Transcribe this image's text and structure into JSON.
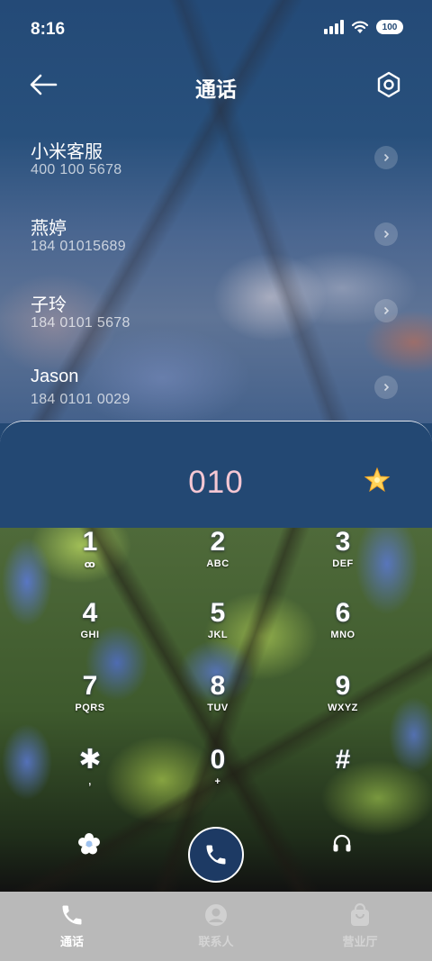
{
  "status_bar": {
    "time": "8:16",
    "battery": "100"
  },
  "header": {
    "title": "通话"
  },
  "contacts": [
    {
      "name": "小米客服",
      "number": "400 100 5678"
    },
    {
      "name": "燕婷",
      "number": "184 01015689"
    },
    {
      "name": "子玲",
      "number": "184 0101 5678"
    },
    {
      "name": "Jason",
      "number": "184 0101 0029"
    }
  ],
  "dialer": {
    "dialed_number": "010",
    "keys": [
      {
        "digit": "1",
        "letters": "ꝏ"
      },
      {
        "digit": "2",
        "letters": "ABC"
      },
      {
        "digit": "3",
        "letters": "DEF"
      },
      {
        "digit": "4",
        "letters": "GHI"
      },
      {
        "digit": "5",
        "letters": "JKL"
      },
      {
        "digit": "6",
        "letters": "MNO"
      },
      {
        "digit": "7",
        "letters": "PQRS"
      },
      {
        "digit": "8",
        "letters": "TUV"
      },
      {
        "digit": "9",
        "letters": "WXYZ"
      },
      {
        "digit": "✱",
        "letters": ","
      },
      {
        "digit": "0",
        "letters": "+"
      },
      {
        "digit": "#",
        "letters": ""
      }
    ]
  },
  "bottom_nav": {
    "items": [
      {
        "label": "通话",
        "icon": "phone-icon",
        "active": true
      },
      {
        "label": "联系人",
        "icon": "contact-icon",
        "active": false
      },
      {
        "label": "营业厅",
        "icon": "bag-icon",
        "active": false
      }
    ]
  },
  "colors": {
    "primary_bg": "#234873",
    "dialed_number": "#f5c7d3",
    "nav_bg": "#b9b9b9"
  }
}
